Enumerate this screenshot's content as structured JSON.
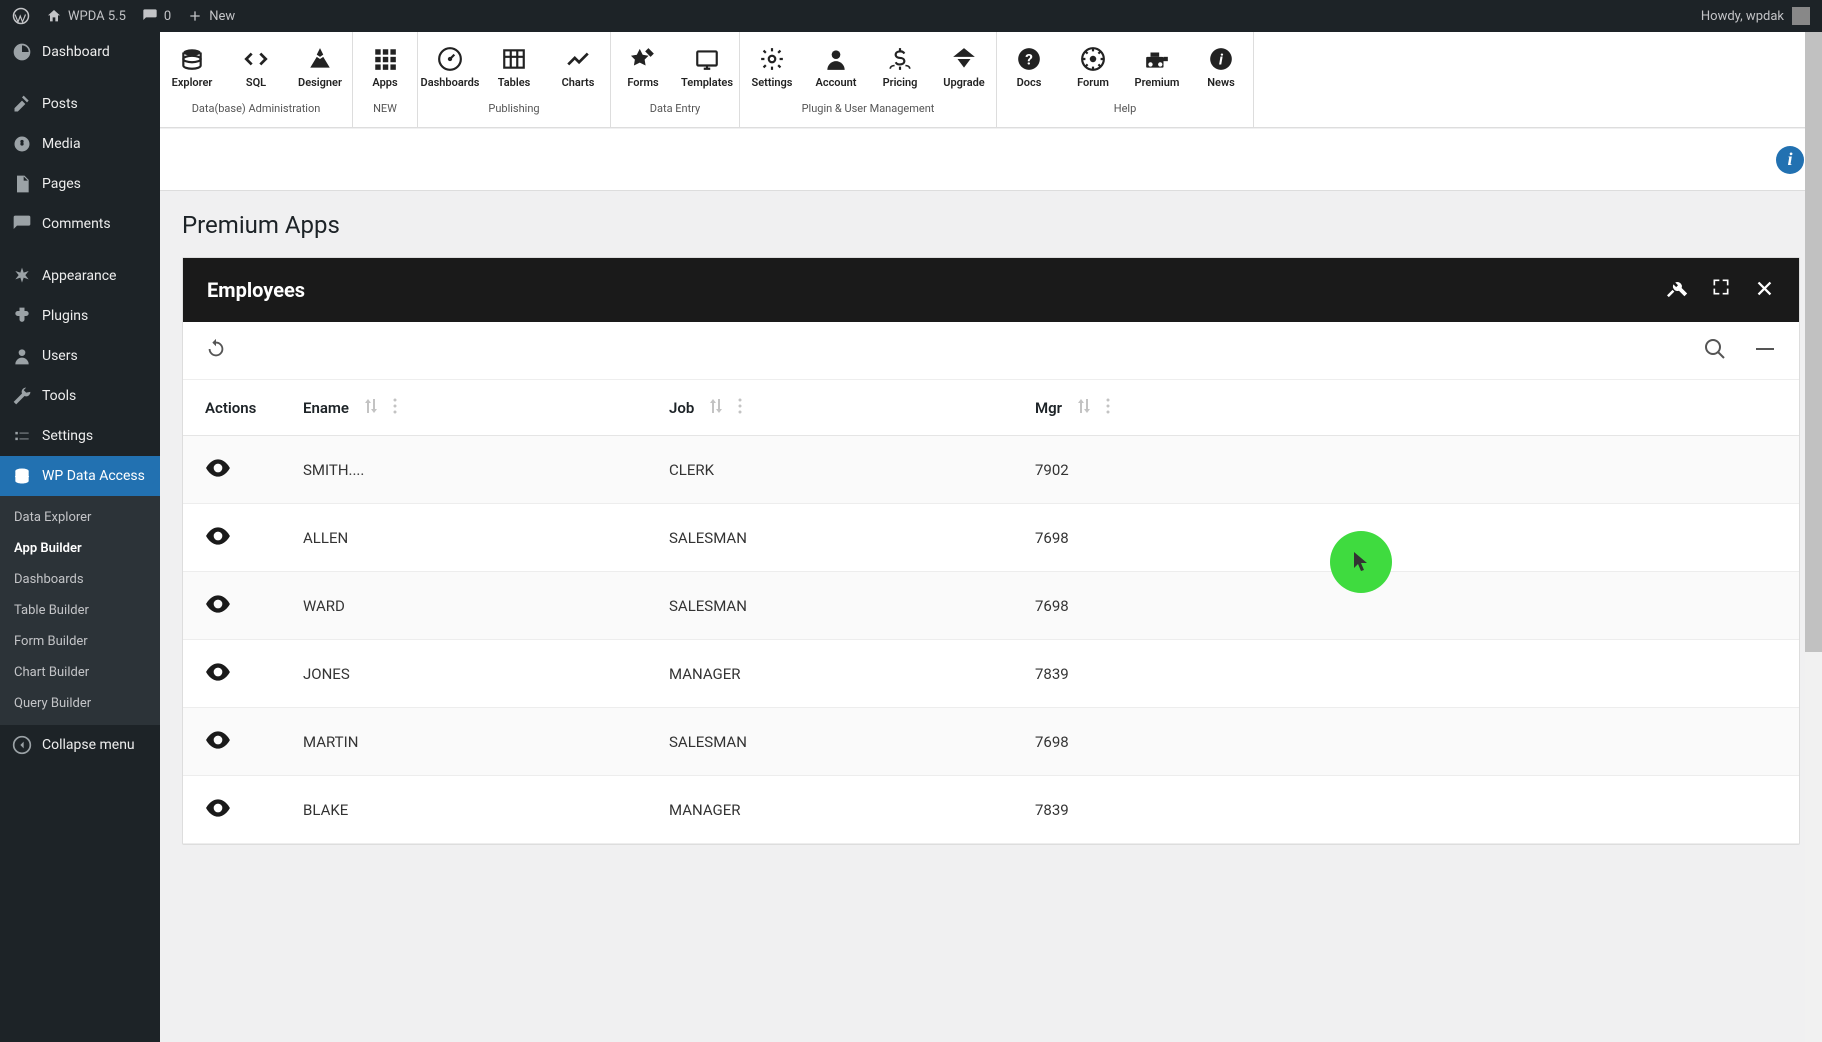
{
  "adminBar": {
    "siteName": "WPDA 5.5",
    "commentCount": "0",
    "newLabel": "New",
    "howdy": "Howdy, wpdak"
  },
  "sidebar": {
    "items": [
      {
        "label": "Dashboard"
      },
      {
        "label": "Posts"
      },
      {
        "label": "Media"
      },
      {
        "label": "Pages"
      },
      {
        "label": "Comments"
      },
      {
        "label": "Appearance"
      },
      {
        "label": "Plugins"
      },
      {
        "label": "Users"
      },
      {
        "label": "Tools"
      },
      {
        "label": "Settings"
      },
      {
        "label": "WP Data Access"
      }
    ],
    "sub": [
      {
        "label": "Data Explorer"
      },
      {
        "label": "App Builder"
      },
      {
        "label": "Dashboards"
      },
      {
        "label": "Table Builder"
      },
      {
        "label": "Form Builder"
      },
      {
        "label": "Chart Builder"
      },
      {
        "label": "Query Builder"
      }
    ],
    "collapse": "Collapse menu"
  },
  "toolbar": {
    "groups": [
      {
        "caption": "Data(base) Administration",
        "items": [
          {
            "label": "Explorer"
          },
          {
            "label": "SQL"
          },
          {
            "label": "Designer"
          }
        ]
      },
      {
        "caption": "",
        "items": [
          {
            "label": "Apps",
            "new": "NEW"
          }
        ]
      },
      {
        "caption": "Publishing",
        "items": [
          {
            "label": "Dashboards"
          },
          {
            "label": "Tables"
          },
          {
            "label": "Charts"
          }
        ]
      },
      {
        "caption": "Data Entry",
        "items": [
          {
            "label": "Forms"
          },
          {
            "label": "Templates"
          }
        ]
      },
      {
        "caption": "Plugin & User Management",
        "items": [
          {
            "label": "Settings"
          },
          {
            "label": "Account"
          },
          {
            "label": "Pricing"
          },
          {
            "label": "Upgrade"
          }
        ]
      },
      {
        "caption": "Help",
        "items": [
          {
            "label": "Docs"
          },
          {
            "label": "Forum"
          },
          {
            "label": "Premium"
          },
          {
            "label": "News"
          }
        ]
      }
    ]
  },
  "page": {
    "title": "Premium Apps"
  },
  "panel": {
    "title": "Employees",
    "columns": {
      "actions": "Actions",
      "ename": "Ename",
      "job": "Job",
      "mgr": "Mgr"
    },
    "rows": [
      {
        "ename": "SMITH....",
        "job": "CLERK",
        "mgr": "7902"
      },
      {
        "ename": "ALLEN",
        "job": "SALESMAN",
        "mgr": "7698"
      },
      {
        "ename": "WARD",
        "job": "SALESMAN",
        "mgr": "7698"
      },
      {
        "ename": "JONES",
        "job": "MANAGER",
        "mgr": "7839"
      },
      {
        "ename": "MARTIN",
        "job": "SALESMAN",
        "mgr": "7698"
      },
      {
        "ename": "BLAKE",
        "job": "MANAGER",
        "mgr": "7839"
      }
    ]
  }
}
